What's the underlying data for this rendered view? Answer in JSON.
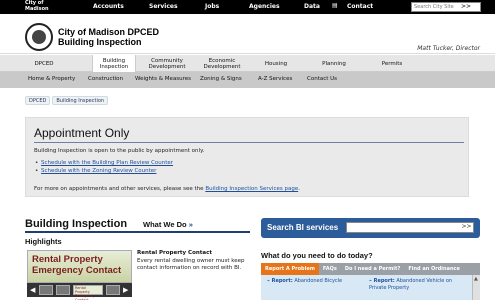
{
  "topbar": {
    "city_line1": "City of",
    "city_line2": "Madison",
    "links": [
      "Accounts",
      "Services",
      "Jobs",
      "Agencies",
      "Data",
      "Contact"
    ],
    "search_placeholder": "Search City Site",
    "search_button": ">>"
  },
  "header": {
    "title_line1": "City of Madison DPCED",
    "title_line2": "Building Inspection",
    "user": "Matt Tucker, Director"
  },
  "nav_main": [
    "DPCED",
    "Building Inspection",
    "Community Development",
    "Economic Development",
    "Housing",
    "Planning",
    "Permits"
  ],
  "nav_sub": [
    "Home & Property",
    "Construction",
    "Weights & Measures",
    "Zoning & Signs",
    "A-Z Services",
    "Contact Us"
  ],
  "breadcrumbs": [
    "DPCED",
    "Building Inspection"
  ],
  "appointment": {
    "heading": "Appointment Only",
    "intro": "Building Inspection is open to the public by appointment only.",
    "links": [
      "Schedule with the Building Plan Review Counter",
      "Schedule with the Zoning Review Counter"
    ],
    "more_prefix": "For more on appointments and other services, please see the ",
    "more_link": "Building Inspection Services page",
    "more_suffix": "."
  },
  "main": {
    "title": "Building Inspection",
    "what_we_do": "What We Do",
    "what_we_do_arrow": "»",
    "highlights": "Highlights",
    "feature_image_line1": "Rental Property",
    "feature_image_line2": "Emergency Contact",
    "thumb_text": "Rental Property Emergency Contact",
    "feature_title": "Rental Property Contact",
    "feature_body": "Every rental dwelling owner must keep contact information on record with BI."
  },
  "sidebar": {
    "search_label": "Search BI services",
    "search_button": ">>",
    "question": "What do you need to do today?",
    "tabs": [
      "Report A Problem",
      "FAQs",
      "Do I need a Permit?",
      "Find an Ordinance"
    ],
    "reports": [
      {
        "label": "Report:",
        "text": "Abandoned Bicycle"
      },
      {
        "label": "Report:",
        "text": "Abandoned Vehicle on Private Property"
      }
    ]
  },
  "colors": {
    "topbar": "#000000",
    "nav_main": "#e6e6e6",
    "nav_sub": "#c9c9c9",
    "search_bar": "#2d5c9a",
    "active_tab": "#e77418",
    "link": "#1d4f9c"
  }
}
